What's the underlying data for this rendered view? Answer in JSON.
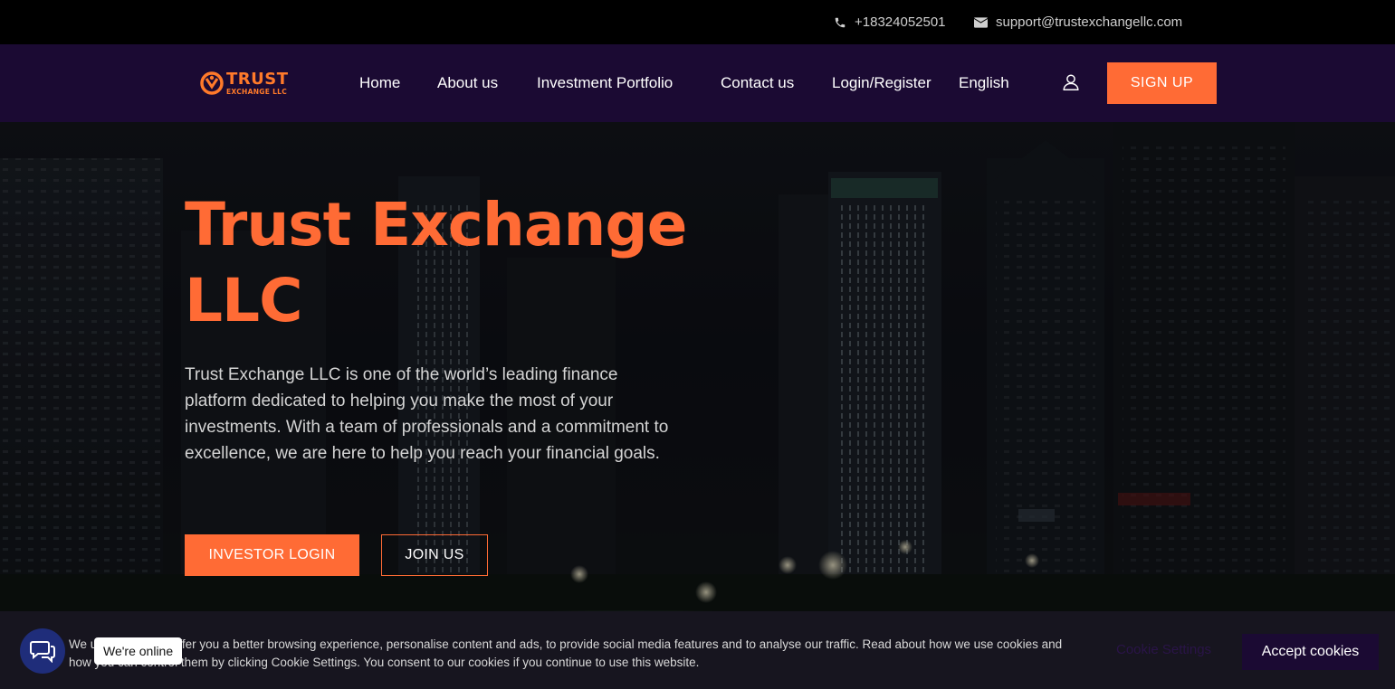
{
  "topbar": {
    "phone": "+18324052501",
    "email": "support@trustexchangellc.com"
  },
  "nav": {
    "logo": {
      "line1": "TRUST",
      "line2": "EXCHANGE LLC"
    },
    "items": [
      {
        "label": "Home"
      },
      {
        "label": "About us"
      },
      {
        "label": "Investment Portfolio"
      },
      {
        "label": "Contact us"
      },
      {
        "label": "Login/Register"
      }
    ],
    "language": "English",
    "signup_label": "SIGN UP"
  },
  "hero": {
    "title": "Trust Exchange LLC",
    "description": "Trust Exchange LLC is one of the world’s leading finance platform dedicated to helping you make the most of your investments. With a team of professionals and a commitment to excellence, we are here to help you reach your financial goals.",
    "investor_login_label": "INVESTOR LOGIN",
    "join_label": "JOIN US"
  },
  "cookie": {
    "text": "We use cookies to offer you a better browsing experience, personalise content and ads, to provide social media features and to analyse our traffic. Read about how we use cookies and how you can control them by clicking Cookie Settings. You consent to our cookies if you continue to use this website.",
    "settings_label": "Cookie Settings",
    "accept_label": "Accept cookies"
  },
  "chat": {
    "status": "We're online"
  },
  "colors": {
    "accent": "#ff6b35",
    "nav_bg": "#1b0a33",
    "chat_blue": "#1f2d7a"
  }
}
